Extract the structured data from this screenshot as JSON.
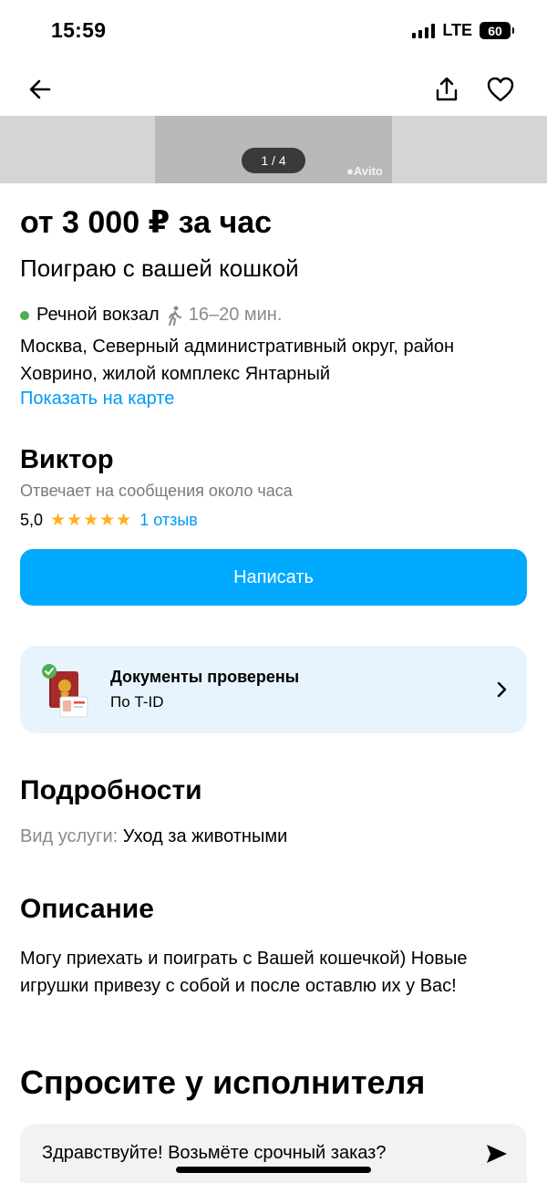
{
  "status": {
    "time": "15:59",
    "network": "LTE",
    "battery": "60"
  },
  "gallery": {
    "counter": "1 / 4",
    "watermark": "Avito"
  },
  "listing": {
    "price": "от 3 000 ₽ за час",
    "title": "Поиграю с вашей кошкой",
    "metro_station": "Речной вокзал",
    "metro_time": "16–20 мин.",
    "address": "Москва, Северный административный округ, район Ховрино, жилой комплекс Янтарный",
    "map_link": "Показать на карте"
  },
  "seller": {
    "name": "Виктор",
    "reply_time": "Отвечает на сообщения около часа",
    "rating": "5,0",
    "stars": "★★★★★",
    "reviews": "1 отзыв"
  },
  "write_button": "Написать",
  "verification": {
    "title": "Документы проверены",
    "subtitle": "По T-ID"
  },
  "details": {
    "heading": "Подробности",
    "label": "Вид услуги:",
    "value": "Уход за животными"
  },
  "description": {
    "heading": "Описание",
    "text": "Могу приехать и поиграть с Вашей кошечкой) Новые игрушки привезу с собой и после оставлю их у Вас!"
  },
  "ask": {
    "heading": "Спросите у исполнителя",
    "message": "Здравствуйте! Возьмёте срочный заказ?"
  },
  "colors": {
    "accent": "#00aaff",
    "link": "#0099f7",
    "metro": "#4cb050",
    "stars": "#ffb020",
    "card": "#e8f4fd"
  }
}
